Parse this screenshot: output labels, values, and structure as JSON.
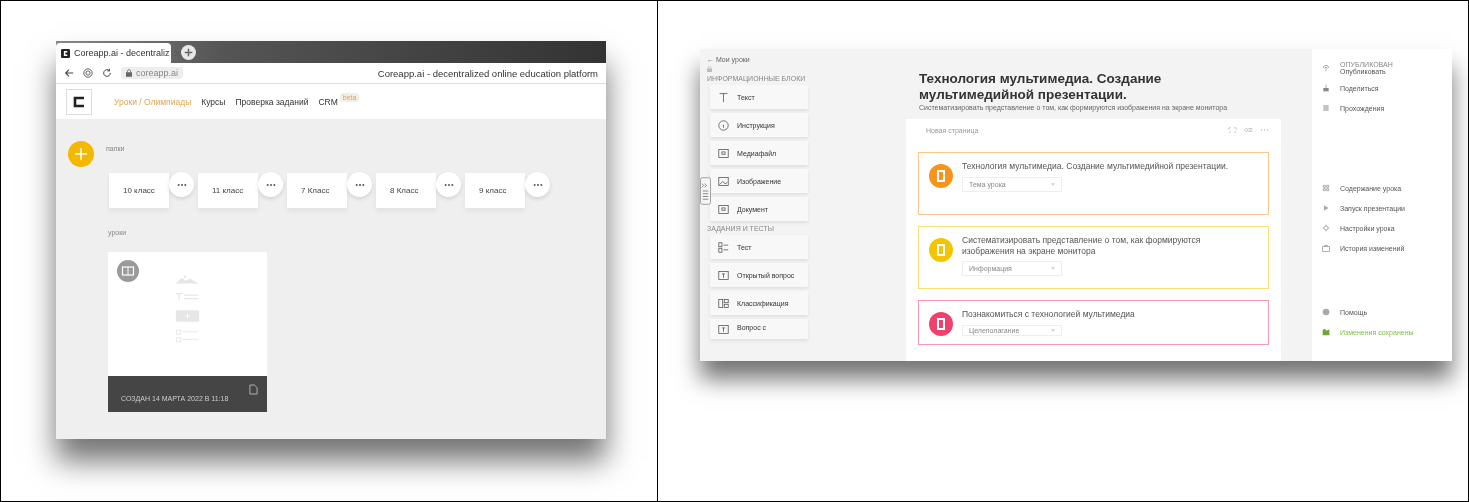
{
  "left_screenshot": {
    "browser_tab": {
      "title": "Coreapp.ai - decentraliz"
    },
    "address": "coreapp.ai",
    "page_title": "Coreapp.ai - decentralized online education platform",
    "nav": [
      {
        "label": "Уроки / Олимпиады",
        "selected": true
      },
      {
        "label": "Курсы",
        "selected": false
      },
      {
        "label": "Проверка заданий",
        "selected": false
      },
      {
        "label": "CRM",
        "selected": false,
        "badge": "beta"
      }
    ],
    "folders_heading": "папки",
    "folders": [
      {
        "label": "10 класс"
      },
      {
        "label": "11 класс"
      },
      {
        "label": "7 Класс"
      },
      {
        "label": "8 Класс"
      },
      {
        "label": "9 класс"
      }
    ],
    "lessons_heading": "уроки",
    "lesson_card": {
      "created": "СОЗДАН 14 МАРТА 2022 В 11:18"
    }
  },
  "right_screenshot": {
    "back_link": "← Мои уроки",
    "info_blocks_heading": "ИНФОРМАЦИОННЫЕ БЛОКИ",
    "info_blocks": [
      {
        "label": "Текст"
      },
      {
        "label": "Инструкция"
      },
      {
        "label": "Медиафайл"
      },
      {
        "label": "Изображение"
      },
      {
        "label": "Документ"
      }
    ],
    "tasks_heading": "ЗАДАНИЯ И ТЕСТЫ",
    "tasks": [
      {
        "label": "Тест"
      },
      {
        "label": "Открытый вопрос"
      },
      {
        "label": "Классификация"
      },
      {
        "label": "Вопрос с"
      }
    ],
    "title": "Технология мультимедиа. Создание мультимедийной презентации.",
    "subtitle": "Систематизировать представление о том, как формируются изображения на экране монитора",
    "page_name": "Новая страница",
    "blocks": [
      {
        "text": "Технология мультимедиа. Создание мультимедийной презентации.",
        "select": "Тема урока",
        "color": "#f7941d"
      },
      {
        "text": "Систематизировать представление о том, как формируются изображения на экране монитора",
        "select": "Информация",
        "color": "#f2c500"
      },
      {
        "text": "Познакомиться с технологией мультимедиа",
        "select": "Целеполагание",
        "color": "#f0416c"
      }
    ],
    "side_menu": [
      {
        "status": "ОПУБЛИКОВАН",
        "label": "Опубликовать"
      },
      {
        "label": "Поделиться"
      },
      {
        "label": "Прохождения"
      }
    ],
    "lesson_menu": [
      {
        "label": "Содержание урока"
      },
      {
        "label": "Запуск презентации"
      },
      {
        "label": "Настройки урока"
      },
      {
        "label": "История изменений"
      }
    ],
    "help": "Помощь",
    "save_status": "Изменения сохранены"
  }
}
